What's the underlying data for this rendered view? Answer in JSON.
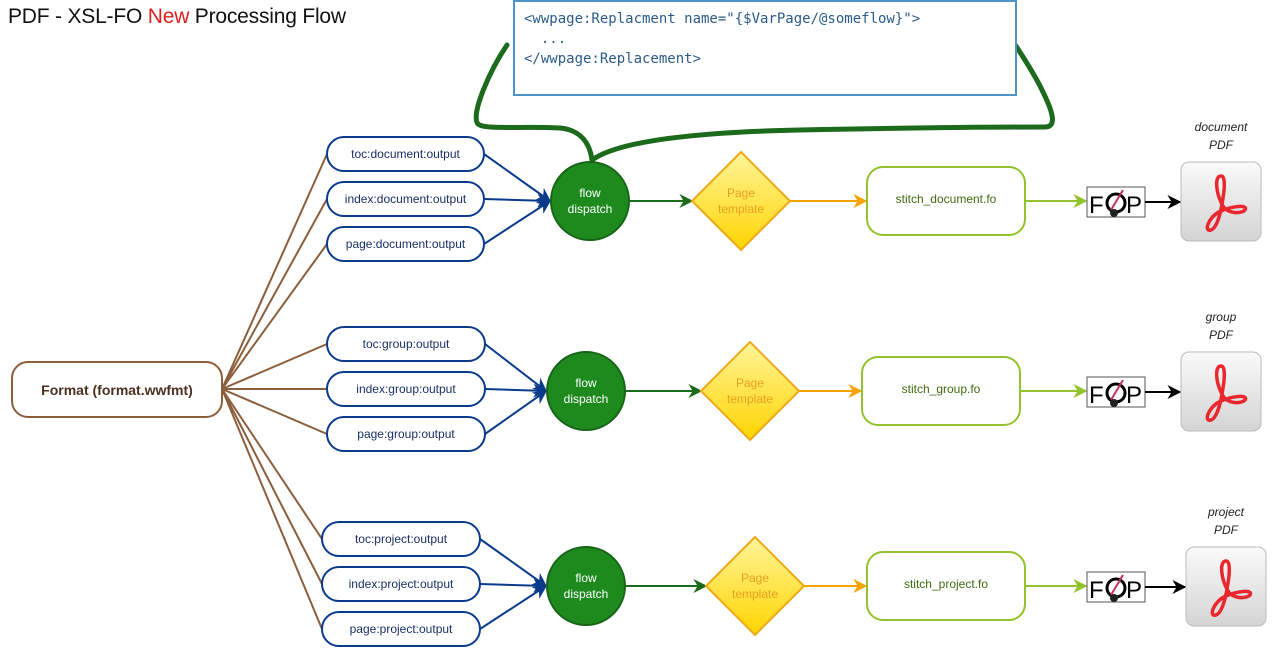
{
  "title": {
    "prefix": "PDF - XSL-FO ",
    "highlight": "New",
    "suffix": " Processing Flow"
  },
  "colors": {
    "highlight": "#e02020",
    "format_border": "#8b5e3c",
    "output_border": "#0a3a8c",
    "dispatch_fill": "#1e8a1e",
    "dispatch_border": "#176617",
    "template_fill": "#ffe033",
    "template_border": "#f0a818",
    "template_arrow": "#f5a300",
    "stitch_border": "#92c32a",
    "code_border": "#4b93cc",
    "bracket": "#1c6a1c"
  },
  "code_snippet": {
    "lines": [
      "<wwpage:Replacment name=\"{$VarPage/@someflow}\">",
      "  ...",
      "</wwpage:Replacement>"
    ]
  },
  "source": {
    "label": "Format (format.wwfmt)"
  },
  "rows": [
    {
      "id": "document",
      "outputs": [
        "toc:document:output",
        "index:document:output",
        "page:document:output"
      ],
      "dispatch": {
        "line1": "flow",
        "line2": "dispatch"
      },
      "template": {
        "line1": "Page",
        "line2": "template"
      },
      "stitch": "stitch_document.fo",
      "processor": "FOP",
      "result": {
        "line1": "document",
        "line2": "PDF",
        "icon": "pdf-icon"
      }
    },
    {
      "id": "group",
      "outputs": [
        "toc:group:output",
        "index:group:output",
        "page:group:output"
      ],
      "dispatch": {
        "line1": "flow",
        "line2": "dispatch"
      },
      "template": {
        "line1": "Page",
        "line2": "template"
      },
      "stitch": "stitch_group.fo",
      "processor": "FOP",
      "result": {
        "line1": "group",
        "line2": "PDF",
        "icon": "pdf-icon"
      }
    },
    {
      "id": "project",
      "outputs": [
        "toc:project:output",
        "index:project:output",
        "page:project:output"
      ],
      "dispatch": {
        "line1": "flow",
        "line2": "dispatch"
      },
      "template": {
        "line1": "Page",
        "line2": "template"
      },
      "stitch": "stitch_project.fo",
      "processor": "FOP",
      "result": {
        "line1": "project",
        "line2": "PDF",
        "icon": "pdf-icon"
      }
    }
  ]
}
